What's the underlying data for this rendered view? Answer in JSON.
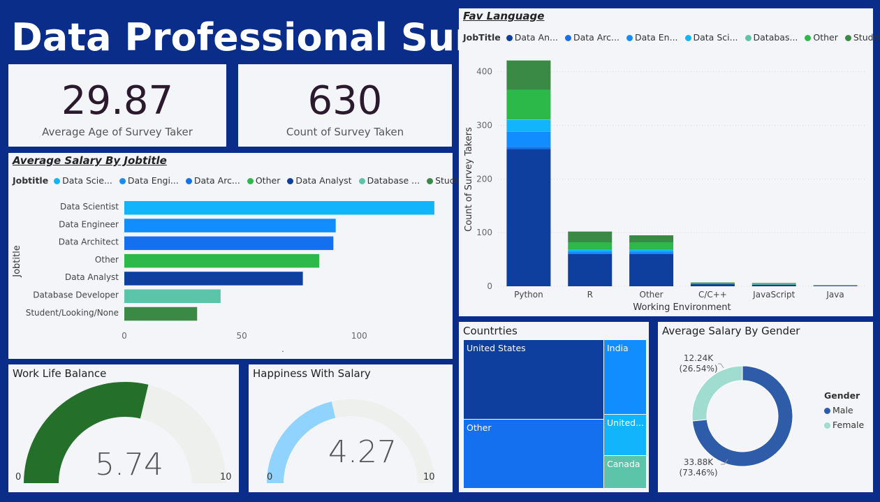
{
  "header": {
    "title": "Data Professional Survey"
  },
  "kpis": [
    {
      "value": "29.87",
      "label": "Average Age of Survey Taker"
    },
    {
      "value": "630",
      "label": "Count of Survey Taken"
    }
  ],
  "salary_by_jobtitle": {
    "title": "Average Salary By Jobtitle",
    "legend_label": "Jobtitle",
    "legend": [
      {
        "label": "Data Scie...",
        "color": "#12b5fb"
      },
      {
        "label": "Data Engi...",
        "color": "#118dff"
      },
      {
        "label": "Data Arc...",
        "color": "#1570ef"
      },
      {
        "label": "Other",
        "color": "#2db84a"
      },
      {
        "label": "Data Analyst",
        "color": "#0e3e9e"
      },
      {
        "label": "Database ...",
        "color": "#5cc4a8"
      },
      {
        "label": "Student/...",
        "color": "#3a8a45"
      }
    ],
    "y_axis_label": "Jobtitle",
    "x_axis_caption": ".",
    "chart_data": {
      "type": "bar",
      "orientation": "horizontal",
      "categories": [
        "Data Scientist",
        "Data Engineer",
        "Data Architect",
        "Other",
        "Data Analyst",
        "Database Developer",
        "Student/Looking/None"
      ],
      "values": [
        132,
        90,
        89,
        83,
        76,
        41,
        31
      ],
      "colors": [
        "#12b5fb",
        "#118dff",
        "#1570ef",
        "#2db84a",
        "#0e3e9e",
        "#5cc4a8",
        "#3a8a45"
      ],
      "xticks": [
        "0",
        "50",
        "100"
      ],
      "xlim": [
        0,
        135
      ],
      "ylabel": "Jobtitle"
    }
  },
  "fav_language": {
    "title": "Fav Language",
    "legend_label": "JobTitle",
    "legend": [
      {
        "label": "Data An...",
        "color": "#0e3e9e"
      },
      {
        "label": "Data Arc...",
        "color": "#1570ef"
      },
      {
        "label": "Data En...",
        "color": "#118dff"
      },
      {
        "label": "Data Sci...",
        "color": "#12b5fb"
      },
      {
        "label": "Databas...",
        "color": "#5cc4a8"
      },
      {
        "label": "Other",
        "color": "#2db84a"
      },
      {
        "label": "Student/...",
        "color": "#3a8a45"
      }
    ],
    "chart_data": {
      "type": "bar",
      "stacked": true,
      "categories": [
        "Python",
        "R",
        "Other",
        "C/C++",
        "JavaScript",
        "Java"
      ],
      "series": [
        {
          "name": "Data An...",
          "color": "#0e3e9e",
          "values": [
            256,
            60,
            60,
            4,
            3,
            1
          ]
        },
        {
          "name": "Data Arc...",
          "color": "#1570ef",
          "values": [
            4,
            2,
            2,
            0,
            0,
            0
          ]
        },
        {
          "name": "Data En...",
          "color": "#118dff",
          "values": [
            28,
            3,
            3,
            0,
            0,
            0
          ]
        },
        {
          "name": "Data Sci...",
          "color": "#12b5fb",
          "values": [
            22,
            3,
            3,
            0,
            0,
            0
          ]
        },
        {
          "name": "Databas...",
          "color": "#5cc4a8",
          "values": [
            1,
            0,
            0,
            0,
            1,
            0
          ]
        },
        {
          "name": "Other",
          "color": "#2db84a",
          "values": [
            55,
            14,
            14,
            1,
            1,
            0
          ]
        },
        {
          "name": "Student/...",
          "color": "#3a8a45",
          "values": [
            55,
            20,
            13,
            2,
            1,
            1
          ]
        }
      ],
      "yticks": [
        "0",
        "100",
        "200",
        "300",
        "400"
      ],
      "ylim": [
        0,
        440
      ],
      "xlabel": "Working Environment",
      "ylabel": "Count of Survey Takers"
    }
  },
  "countries": {
    "title": "Countrties",
    "chart_data": {
      "type": "treemap",
      "items": [
        {
          "label": "United States",
          "color": "#0e3e9e"
        },
        {
          "label": "Other",
          "color": "#1570ef"
        },
        {
          "label": "India",
          "color": "#118dff"
        },
        {
          "label": "United...",
          "color": "#12b5fb"
        },
        {
          "label": "Canada",
          "color": "#5cc4a8"
        }
      ]
    }
  },
  "salary_by_gender": {
    "title": "Average Salary By Gender",
    "legend_title": "Gender",
    "chart_data": {
      "type": "pie",
      "donut": true,
      "slices": [
        {
          "label": "Male",
          "value": 33.88,
          "value_label": "33.88K",
          "pct_label": "(73.46%)",
          "color": "#2e5ca8"
        },
        {
          "label": "Female",
          "value": 12.24,
          "value_label": "12.24K",
          "pct_label": "(26.54%)",
          "color": "#a0ddd0"
        }
      ]
    }
  },
  "work_life": {
    "title": "Work Life Balance",
    "value": 5.74,
    "value_label": "5.74",
    "min": "0",
    "max": "10",
    "min_num": 0,
    "max_num": 10,
    "color": "#246f29",
    "track": "#eef0ee"
  },
  "happiness": {
    "title": "Happiness With Salary",
    "value": 4.27,
    "value_label": "4.27",
    "min": "0",
    "max": "10",
    "min_num": 0,
    "max_num": 10,
    "color": "#8fd3fe",
    "track": "#eef0ee"
  }
}
